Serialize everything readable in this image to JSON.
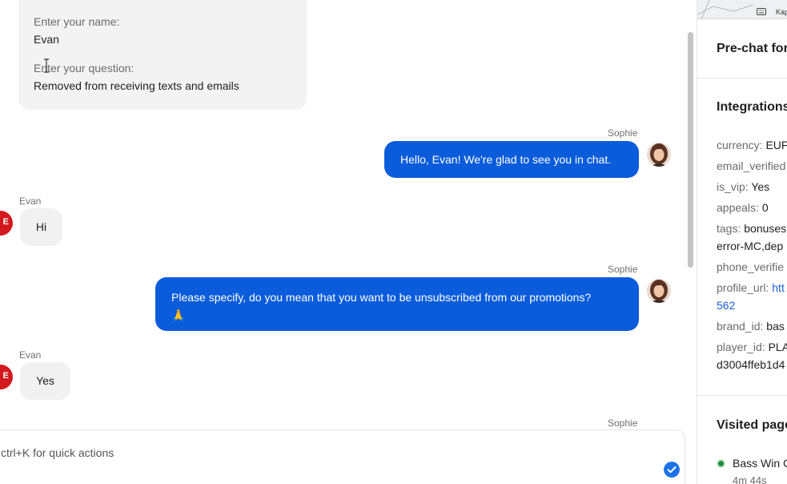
{
  "prechat_form": {
    "name_label": "Enter your name:",
    "name_value": "Evan",
    "question_label": "Enter your question:",
    "question_value": "Removed from receiving texts and emails"
  },
  "messages": [
    {
      "sender": "Sophie",
      "text": "Hello, Evan! We're glad to see you in chat.",
      "side": "agent"
    },
    {
      "sender": "Evan",
      "text": "Hi",
      "side": "user"
    },
    {
      "sender": "Sophie",
      "text": "Please specify, do you mean that you want to be unsubscribed from our promotions?",
      "emoji": "🙏",
      "side": "agent"
    },
    {
      "sender": "Evan",
      "text": "Yes",
      "side": "user"
    },
    {
      "sender": "Sophie",
      "side": "agent"
    }
  ],
  "user_avatar_letter": "E",
  "composer": {
    "placeholder": "ctrl+K for quick actions"
  },
  "map": {
    "text": "Kap"
  },
  "panel": {
    "prechat_title": "Pre-chat for",
    "integrations_title": "Integrations",
    "fields": {
      "currency": {
        "key": "currency:",
        "value": "EUF"
      },
      "email_verified": {
        "key": "email_verified"
      },
      "is_vip": {
        "key": "is_vip:",
        "value": "Yes"
      },
      "appeals": {
        "key": "appeals:",
        "value": "0"
      },
      "tags": {
        "key": "tags:",
        "value": "bonuses",
        "value_line2": "error-MC,dep"
      },
      "phone_verified": {
        "key": "phone_verifie"
      },
      "profile_url": {
        "key": "profile_url:",
        "value": "htt",
        "value_line2": "562"
      },
      "brand_id": {
        "key": "brand_id:",
        "value": "bas"
      },
      "player_id": {
        "key": "player_id:",
        "value": "PLA",
        "value_line2": "d3004ffeb1d4"
      }
    },
    "visited_title": "Visited page",
    "visited_item": {
      "title": "Bass Win C",
      "time": "4m 44s"
    }
  },
  "colors": {
    "agent_bubble": "#0b5cdb",
    "user_bubble": "#f1f1f1",
    "user_avatar": "#d2191d",
    "link": "#1a5fd6",
    "online_dot": "#1e8e3e"
  }
}
